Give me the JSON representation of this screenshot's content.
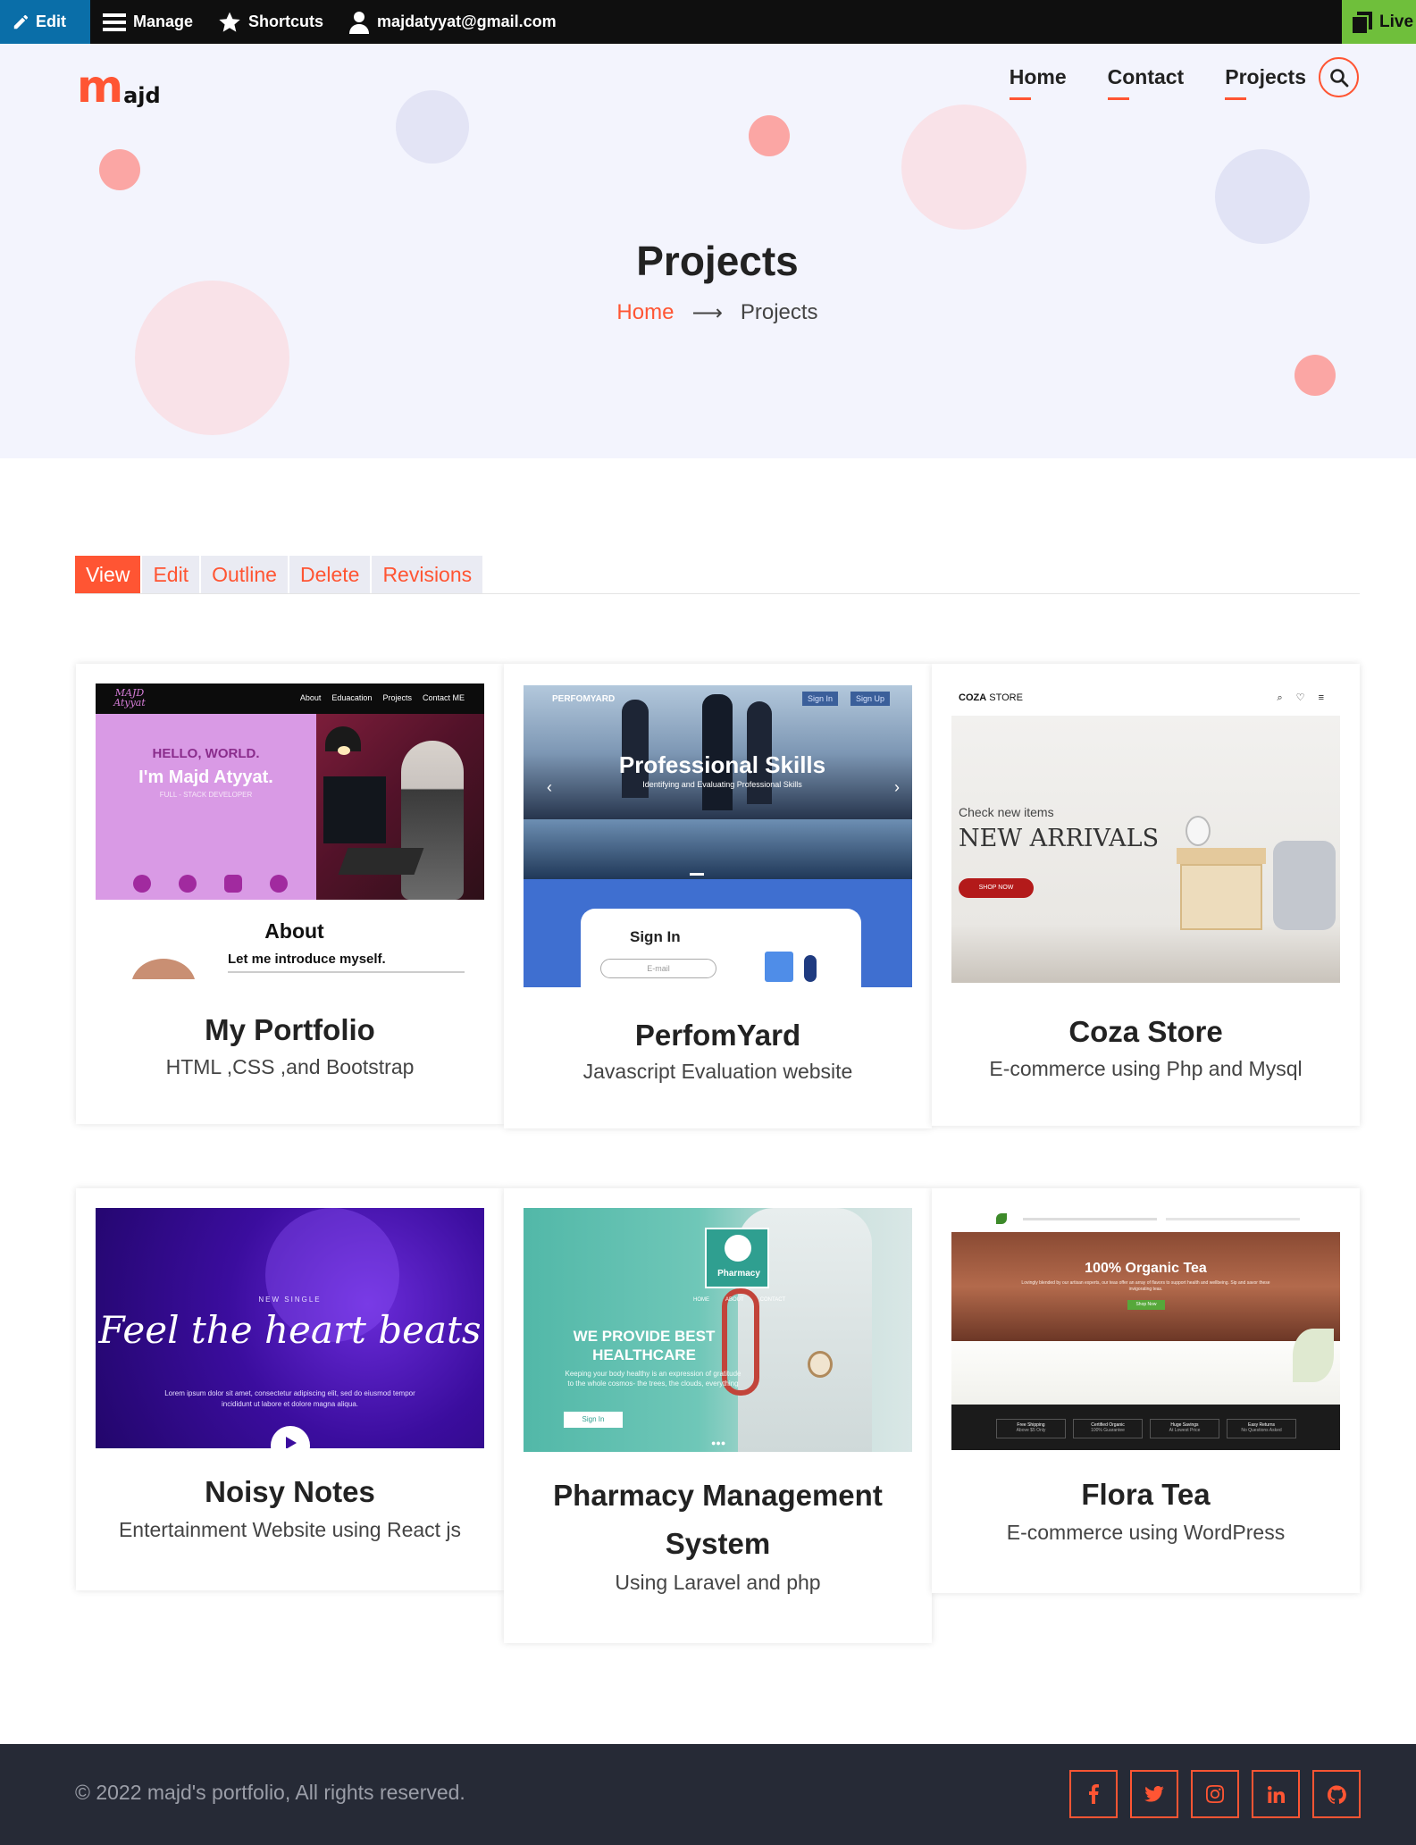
{
  "admin_toolbar": {
    "edit": "Edit",
    "manage": "Manage",
    "shortcuts": "Shortcuts",
    "user": "majdatyyat@gmail.com",
    "live": "Live"
  },
  "brand": {
    "logo_m": "m",
    "logo_rest": "ajd"
  },
  "nav": {
    "home": "Home",
    "contact": "Contact",
    "projects": "Projects"
  },
  "hero": {
    "title": "Projects",
    "breadcrumb_home": "Home",
    "breadcrumb_sep": "⟶",
    "breadcrumb_current": "Projects"
  },
  "tabs": {
    "view": "View",
    "edit": "Edit",
    "outline": "Outline",
    "delete": "Delete",
    "revisions": "Revisions"
  },
  "projects": [
    {
      "title": "My Portfolio",
      "description": "HTML ,CSS ,and Bootstrap",
      "thumb": {
        "logo": "MAJD Atyyat",
        "nav": [
          "About",
          "Eduacation",
          "Projects",
          "Contact ME"
        ],
        "hello": "HELLO, WORLD.",
        "name": "I'm Majd Atyyat.",
        "role": "FULL - STACK DEVELOPER",
        "section": "About",
        "intro": "Let me introduce myself."
      }
    },
    {
      "title": "PerfomYard",
      "description": "Javascript Evaluation website",
      "thumb": {
        "brand": "PERFOMYARD",
        "signin_btn": "Sign In",
        "signup_btn": "Sign Up",
        "headline": "Professional Skills",
        "subline": "Identifying and Evaluating Professional Skills",
        "form_title": "Sign In",
        "email_placeholder": "E-mail"
      }
    },
    {
      "title": "Coza Store",
      "description": "E-commerce using Php and Mysql",
      "thumb": {
        "brand_bold": "COZA",
        "brand_light": " STORE",
        "kicker": "Check new items",
        "headline": "NEW ARRIVALS",
        "cta": "SHOP NOW"
      }
    },
    {
      "title": "Noisy Notes",
      "description": "Entertainment Website using React js",
      "thumb": {
        "kicker": "NEW SINGLE",
        "headline": "Feel the heart beats",
        "body": "Lorem ipsum dolor sit amet, consectetur adipiscing elit, sed do eiusmod tempor incididunt ut labore et dolore magna aliqua."
      }
    },
    {
      "title": "Pharmacy Management System",
      "description": "Using Laravel and php",
      "thumb": {
        "logo_text": "Pharmacy",
        "nav": [
          "HOME",
          "ABOUT",
          "CONTACT"
        ],
        "headline": "WE PROVIDE BEST HEALTHCARE",
        "body": "Keeping your body healthy is an expression of gratitude to the whole cosmos- the trees, the clouds, everything",
        "cta": "Sign In"
      }
    },
    {
      "title": "Flora Tea",
      "description": "E-commerce using WordPress",
      "thumb": {
        "headline": "100% Organic Tea",
        "body": "Lovingly blended by our artisan experts, our teas offer an array of flavors to support health and wellbeing. Sip and savor these invigorating teas.",
        "cta": "Shop Now",
        "features": [
          {
            "title": "Free Shipping",
            "sub": "Above $5 Only"
          },
          {
            "title": "Certified Organic",
            "sub": "100% Guarantee"
          },
          {
            "title": "Huge Savings",
            "sub": "At Lowest Price"
          },
          {
            "title": "Easy Returns",
            "sub": "No Questions Asked"
          }
        ]
      }
    }
  ],
  "footer": {
    "copyright": "© 2022 majd's portfolio, All rights reserved.",
    "socials": [
      "facebook-icon",
      "twitter-icon",
      "instagram-icon",
      "linkedin-icon",
      "github-icon"
    ]
  },
  "colors": {
    "accent": "#ff5533",
    "hero_bg": "#f3f4fd",
    "footer_bg": "#262a36",
    "admin_bg": "#0f0f0f",
    "admin_edit": "#0a6ea8",
    "admin_live": "#6fbf3b"
  }
}
